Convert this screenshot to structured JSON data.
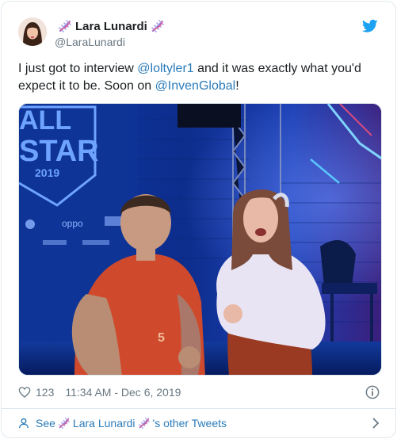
{
  "author": {
    "display_name": "Lara Lunardi",
    "handle": "@LaraLunardi"
  },
  "tweet": {
    "text_1": "I just got to interview ",
    "mention_1": "@loltyler1",
    "text_2": " and it was exactly what you'd expect it to be. Soon on ",
    "mention_2": "@InvenGlobal",
    "text_3": "!"
  },
  "media": {
    "banner_line_1": "ALL",
    "banner_line_2": "STAR",
    "banner_year": "2019",
    "sponsor_1": "oppo"
  },
  "meta": {
    "likes": "123",
    "timestamp": "11:34 AM - Dec 6, 2019"
  },
  "footer": {
    "see_label": "See",
    "name": "Lara Lunardi",
    "suffix": "'s other Tweets"
  },
  "colors": {
    "link": "#2b7bb9",
    "twitter_blue": "#1da1f2",
    "muted": "#697882"
  }
}
